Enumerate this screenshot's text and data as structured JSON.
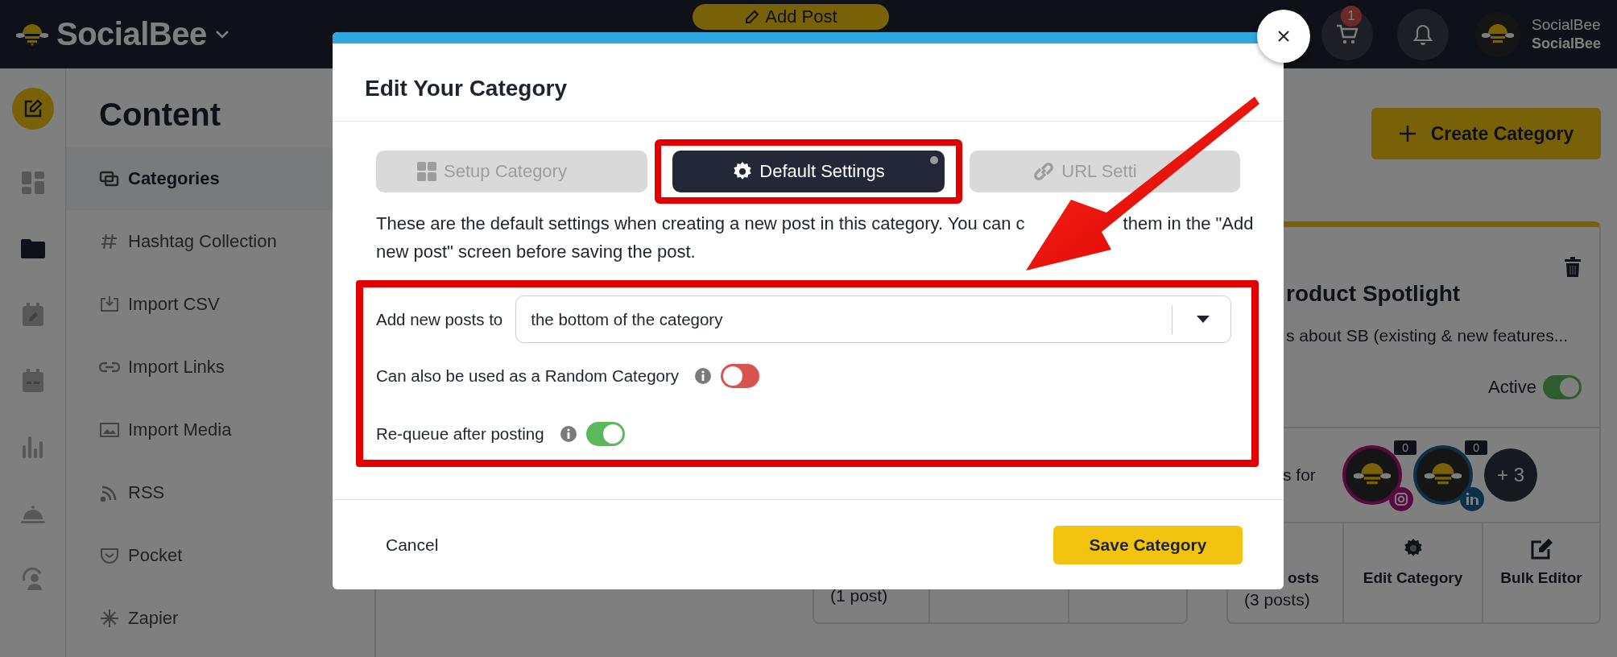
{
  "top_bar": {
    "brand": "SocialBee",
    "add_post": "Add Post",
    "cart_count": "1",
    "account_name": "SocialBee",
    "account_sub": "SocialBee"
  },
  "sidebar": {
    "title": "Content",
    "items": [
      {
        "label": "Categories",
        "selected": true
      },
      {
        "label": "Hashtag Collection",
        "selected": false
      },
      {
        "label": "Import CSV",
        "selected": false
      },
      {
        "label": "Import Links",
        "selected": false
      },
      {
        "label": "Import Media",
        "selected": false
      },
      {
        "label": "RSS",
        "selected": false
      },
      {
        "label": "Pocket",
        "selected": false
      },
      {
        "label": "Zapier",
        "selected": false
      }
    ]
  },
  "main": {
    "create_button": "Create Category",
    "left_card": {
      "actions": [
        {
          "sub": "(1 post)"
        }
      ]
    },
    "right_card": {
      "title": "roduct Spotlight",
      "description": "s about SB (existing & new features...",
      "status_label": "Active",
      "active": true,
      "profiles_label": "s for",
      "profiles": [
        {
          "count": "0",
          "kind": "instagram"
        },
        {
          "count": "0",
          "kind": "linkedin"
        }
      ],
      "more": "+ 3",
      "actions": [
        {
          "label": "osts",
          "sub": "(3 posts)"
        },
        {
          "label": "Edit Category"
        },
        {
          "label": "Bulk Editor"
        }
      ]
    }
  },
  "modal": {
    "title": "Edit Your Category",
    "tabs": [
      {
        "label": "Setup Category",
        "selected": false
      },
      {
        "label": "Default Settings",
        "selected": true
      },
      {
        "label": "URL Setti",
        "selected": false
      }
    ],
    "description_before": "These are the default settings when creating a new post in this category. You can c",
    "description_after": "them in the \"Add",
    "description_line2": "new post\" screen before saving the post.",
    "position_label": "Add new posts to",
    "position_value": "the bottom of the category",
    "toggles": [
      {
        "label": "Can also be used as a Random Category",
        "on": false
      },
      {
        "label": "Re-queue after posting",
        "on": true
      }
    ],
    "cancel": "Cancel",
    "save": "Save Category"
  }
}
